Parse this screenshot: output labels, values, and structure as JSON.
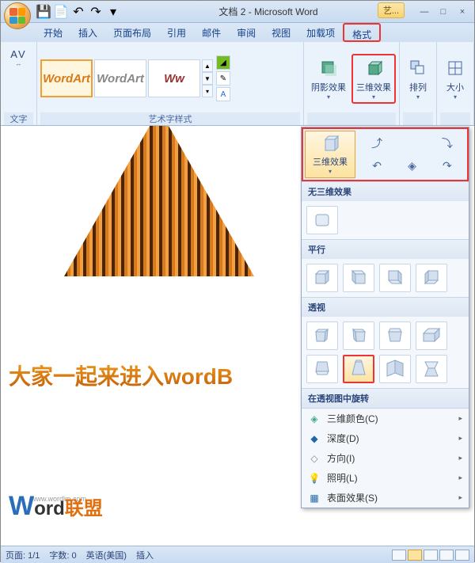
{
  "app": {
    "title": "文档 2 - Microsoft Word",
    "contextTab": "艺..."
  },
  "qat": {
    "save": "💾",
    "undo": "↶",
    "redo": "↷",
    "new": "📄"
  },
  "winctrl": {
    "min": "—",
    "max": "□",
    "close": "×"
  },
  "tabs": [
    "开始",
    "插入",
    "页面布局",
    "引用",
    "邮件",
    "审阅",
    "视图",
    "加载项",
    "格式"
  ],
  "ribbon": {
    "textGroup": {
      "spacing": "AV",
      "label": "文字"
    },
    "gallery": {
      "label": "艺术字样式",
      "items": [
        "WordArt",
        "WordArt",
        "Ww"
      ]
    },
    "shadow": "阴影效果",
    "effect3d": "三维效果",
    "arrange": "排列",
    "size": "大小"
  },
  "popup": {
    "effect3dBtn": "三维效果",
    "none": {
      "header": "无三维效果"
    },
    "parallel": {
      "header": "平行"
    },
    "perspective": {
      "header": "透视"
    },
    "rotate": {
      "header": "在透视图中旋转"
    },
    "menu": [
      {
        "icon": "◈",
        "label": "三维颜色(C)"
      },
      {
        "icon": "◆",
        "label": "深度(D)"
      },
      {
        "icon": "◇",
        "label": "方向(I)"
      },
      {
        "icon": "💡",
        "label": "照明(L)"
      },
      {
        "icon": "▦",
        "label": "表面效果(S)"
      }
    ]
  },
  "document": {
    "wordart": "大家一起来进入wordB",
    "watermarkUrl": "www.wordlm.com",
    "watermarkW": "W",
    "watermarkOrd": "ord",
    "watermarkLm": "联盟"
  },
  "status": {
    "page": "页面: 1/1",
    "words": "字数: 0",
    "lang": "英语(美国)",
    "mode": "插入"
  }
}
